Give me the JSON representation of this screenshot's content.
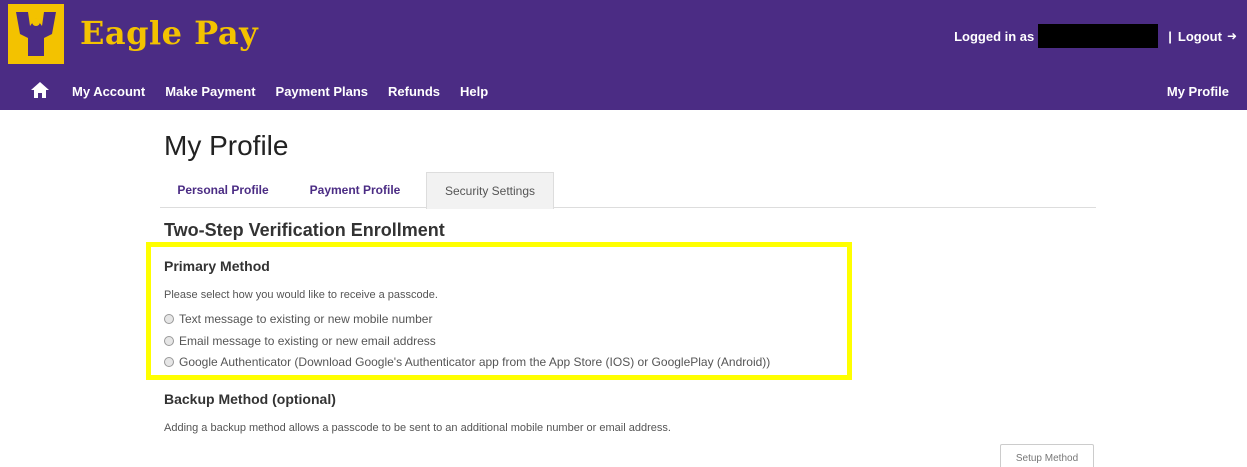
{
  "brand": {
    "name": "Eagle Pay",
    "primary_color": "#4b2c84",
    "accent_color": "#f3c200",
    "logo_icon": "eagle-logo-icon"
  },
  "header": {
    "logged_in_label": "Logged in as",
    "logout_label": "Logout",
    "logout_icon": "logout-arrow-icon"
  },
  "nav": {
    "home_icon": "home-icon",
    "items": [
      "My Account",
      "Make Payment",
      "Payment Plans",
      "Refunds",
      "Help"
    ],
    "right_item": "My Profile"
  },
  "page": {
    "title": "My Profile"
  },
  "tabs": [
    {
      "label": "Personal Profile",
      "active": false
    },
    {
      "label": "Payment Profile",
      "active": false
    },
    {
      "label": "Security Settings",
      "active": true
    }
  ],
  "enrollment": {
    "title": "Two-Step Verification Enrollment",
    "primary": {
      "title": "Primary Method",
      "prompt": "Please select how you would like to receive a passcode.",
      "options": [
        "Text message to existing or new mobile number",
        "Email message to existing or new email address",
        "Google Authenticator (Download Google's Authenticator app from the App Store (IOS) or GooglePlay (Android))"
      ]
    },
    "backup": {
      "title": "Backup Method (optional)",
      "description": "Adding a backup method allows a passcode to be sent to an additional mobile number or email address.",
      "button_label": "Setup Method"
    },
    "highlight_color": "#ffff00"
  }
}
